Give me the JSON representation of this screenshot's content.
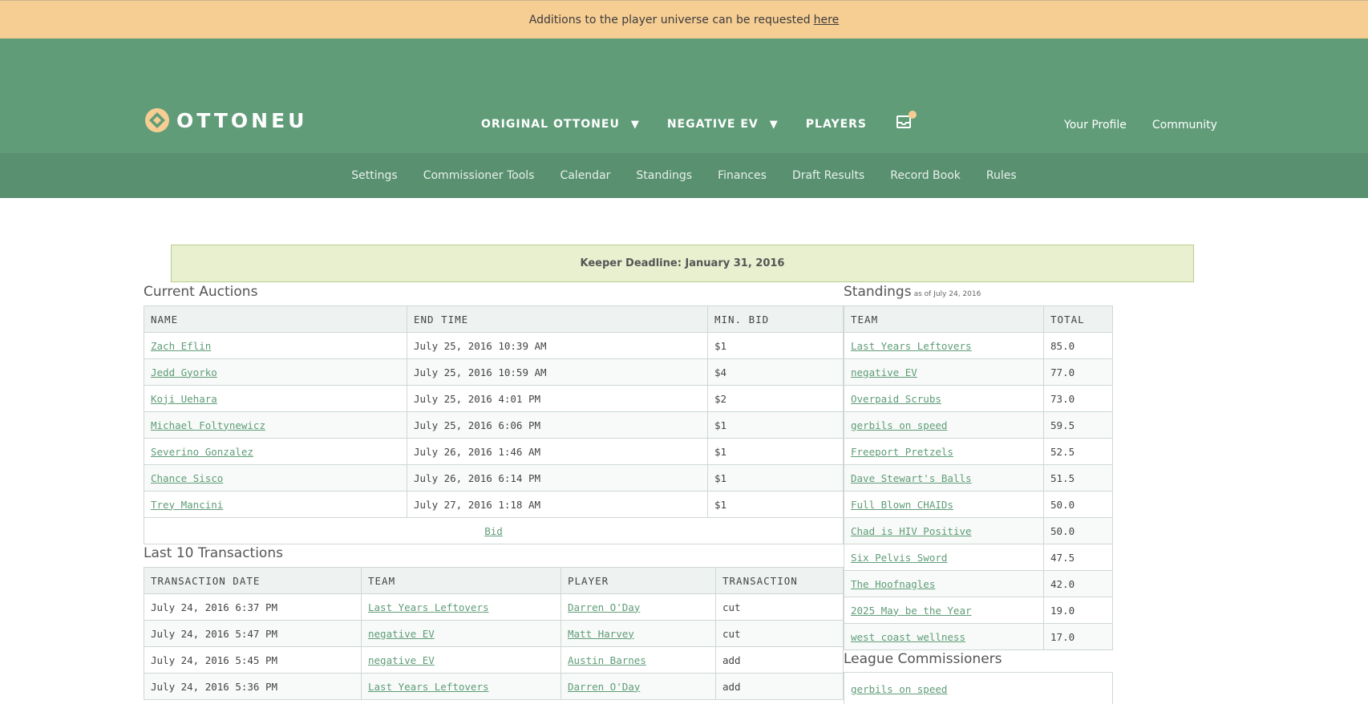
{
  "announcement": {
    "text": "Additions to the player universe can be requested",
    "link": "here"
  },
  "header": {
    "logo_text": "OTTONEU",
    "nav": [
      {
        "label": "ORIGINAL OTTONEU",
        "caret": "▼"
      },
      {
        "label": "NEGATIVE EV",
        "caret": "▼"
      },
      {
        "label": "PLAYERS"
      }
    ],
    "user_links": [
      "Your Profile",
      "Community"
    ]
  },
  "subnav": [
    "Settings",
    "Commissioner Tools",
    "Calendar",
    "Standings",
    "Finances",
    "Draft Results",
    "Record Book",
    "Rules"
  ],
  "keeper_deadline": "Keeper Deadline: January 31, 2016",
  "auctions": {
    "title": "Current Auctions",
    "columns": [
      "NAME",
      "END TIME",
      "MIN. BID"
    ],
    "rows": [
      [
        "Zach Eflin",
        "July 25, 2016 10:39 AM",
        "$1"
      ],
      [
        "Jedd Gyorko",
        "July 25, 2016 10:59 AM",
        "$4"
      ],
      [
        "Koji Uehara",
        "July 25, 2016 4:01 PM",
        "$2"
      ],
      [
        "Michael Foltynewicz",
        "July 25, 2016 6:06 PM",
        "$1"
      ],
      [
        "Severino Gonzalez",
        "July 26, 2016 1:46 AM",
        "$1"
      ],
      [
        "Chance Sisco",
        "July 26, 2016 6:14 PM",
        "$1"
      ],
      [
        "Trey Mancini",
        "July 27, 2016 1:18 AM",
        "$1"
      ]
    ],
    "bid_label": "Bid"
  },
  "transactions": {
    "title": "Last 10 Transactions",
    "columns": [
      "TRANSACTION DATE",
      "TEAM",
      "PLAYER",
      "TRANSACTION"
    ],
    "rows": [
      [
        "July 24, 2016 6:37 PM",
        "Last Years Leftovers",
        "Darren O'Day",
        "cut"
      ],
      [
        "July 24, 2016 5:47 PM",
        "negative EV",
        "Matt Harvey",
        "cut"
      ],
      [
        "July 24, 2016 5:45 PM",
        "negative EV",
        "Austin Barnes",
        "add"
      ],
      [
        "July 24, 2016 5:36 PM",
        "Last Years Leftovers",
        "Darren O'Day",
        "add"
      ]
    ]
  },
  "standings": {
    "title": "Standings",
    "subtitle": "as of July 24, 2016",
    "columns": [
      "TEAM",
      "TOTAL"
    ],
    "rows": [
      [
        "Last Years Leftovers",
        "85.0"
      ],
      [
        "negative EV",
        "77.0"
      ],
      [
        "Overpaid Scrubs",
        "73.0"
      ],
      [
        "gerbils on speed",
        "59.5"
      ],
      [
        "Freeport Pretzels",
        "52.5"
      ],
      [
        "Dave Stewart's Balls",
        "51.5"
      ],
      [
        "Full Blown CHAIDs",
        "50.0"
      ],
      [
        "Chad is HIV Positive",
        "50.0"
      ],
      [
        "Six Pelvis Sword",
        "47.5"
      ],
      [
        "The Hoofnagles",
        "42.0"
      ],
      [
        "2025 May be the Year",
        "19.0"
      ],
      [
        "west coast wellness",
        "17.0"
      ]
    ]
  },
  "commissioners": {
    "title": "League Commissioners",
    "names": [
      "gerbils on speed"
    ]
  },
  "colors": {
    "accent": "#619c79",
    "banner": "#f6cd93",
    "link": "#5f9c77"
  }
}
